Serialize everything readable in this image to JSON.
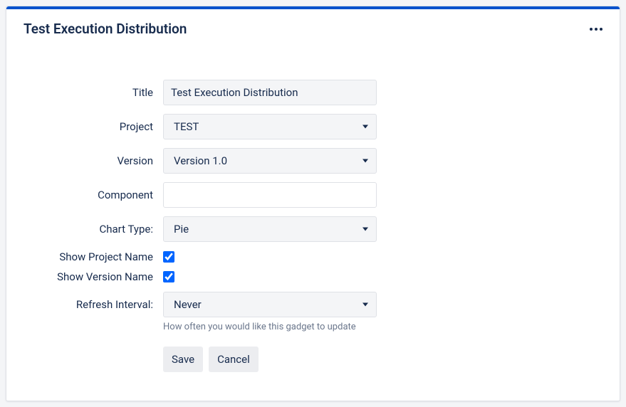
{
  "header": {
    "title": "Test Execution Distribution"
  },
  "form": {
    "title_label": "Title",
    "title_value": "Test Execution Distribution",
    "project_label": "Project",
    "project_value": "TEST",
    "version_label": "Version",
    "version_value": "Version 1.0",
    "component_label": "Component",
    "component_value": "",
    "chart_type_label": "Chart Type:",
    "chart_type_value": "Pie",
    "show_project_name_label": "Show Project Name",
    "show_project_name_checked": true,
    "show_version_name_label": "Show Version Name",
    "show_version_name_checked": true,
    "refresh_label": "Refresh Interval:",
    "refresh_value": "Never",
    "refresh_help": "How often you would like this gadget to update",
    "save_label": "Save",
    "cancel_label": "Cancel"
  }
}
